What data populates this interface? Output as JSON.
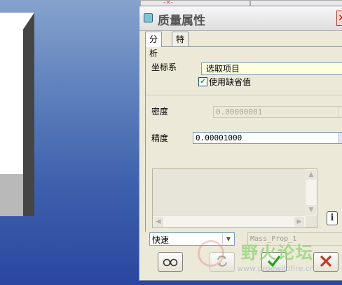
{
  "dialog": {
    "title": "质量属性",
    "tabs": [
      {
        "label": "分析"
      },
      {
        "label": "特征"
      }
    ],
    "coord_system": {
      "label": "坐标系",
      "value": "选取项目"
    },
    "use_default": {
      "label": "使用缺省值",
      "checked": true
    },
    "density": {
      "label": "密度",
      "value": "0.00000001"
    },
    "precision": {
      "label": "精度",
      "value": "0.00001000"
    },
    "mode": {
      "value": "快速"
    },
    "name_field": {
      "value": "Mass_Prop_1"
    },
    "info_icon_text": "i"
  },
  "watermark": {
    "text": "野火论坛",
    "url": "www.proewildfire.cn"
  },
  "colors": {
    "viewport_top": "#86a3cd",
    "viewport_bottom": "#2a46a0",
    "dialog_bg": "#ece9d8",
    "highlight_field": "#ffffe1",
    "ok_green": "#21a121",
    "cancel_red": "#c0392b"
  }
}
